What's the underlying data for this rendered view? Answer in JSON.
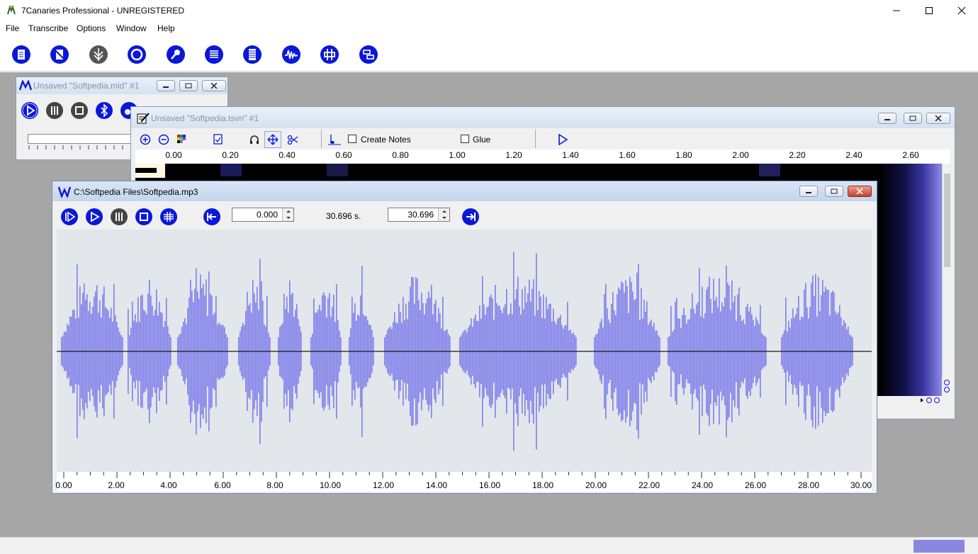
{
  "app": {
    "title": "7Canaries Professional - UNREGISTERED"
  },
  "menu": [
    "File",
    "Transcribe",
    "Options",
    "Window",
    "Help"
  ],
  "toolbar_icons": [
    "new-document-icon",
    "no-document-icon",
    "leaf-icon",
    "record-circle-icon",
    "microphone-icon",
    "list-icon",
    "filmstrip-icon",
    "waveform-icon",
    "split-icon",
    "merge-icon"
  ],
  "midi_window": {
    "title": "Unsaved \"Softpedia.mid\" #1"
  },
  "tsvn_window": {
    "title": "Unsaved \"Softpedia.tsvn\" #1",
    "create_notes_label": "Create Notes",
    "glue_label": "Glue",
    "ruler": [
      "0.00",
      "0.20",
      "0.40",
      "0.60",
      "0.80",
      "1.00",
      "1.20",
      "1.40",
      "1.60",
      "1.80",
      "2.00",
      "2.20",
      "2.40",
      "2.60"
    ]
  },
  "mp3_window": {
    "title": "C:\\Softpedia Files\\Softpedia.mp3",
    "start_value": "0.000",
    "duration_label": "30.696 s.",
    "end_value": "30.696",
    "ruler": [
      "0.00",
      "2.00",
      "4.00",
      "6.00",
      "8.00",
      "10.00",
      "12.00",
      "14.00",
      "16.00",
      "18.00",
      "20.00",
      "22.00",
      "24.00",
      "26.00",
      "28.00",
      "30.00"
    ],
    "waveform_color": "#7f7fea"
  },
  "colors": {
    "accent": "#0a18d8",
    "mdi_background": "#a6a6a6",
    "waveform_bg": "#e3e6ea"
  }
}
